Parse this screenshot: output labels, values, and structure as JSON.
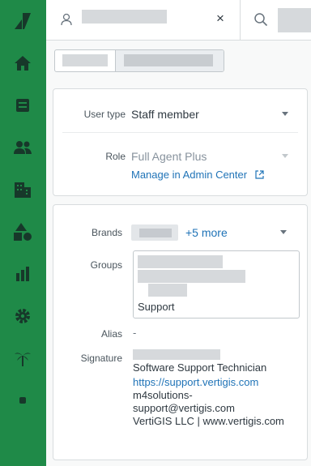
{
  "sidebar": {
    "items": [
      {
        "name": "zendesk-logo-icon"
      },
      {
        "name": "home-icon"
      },
      {
        "name": "views-icon"
      },
      {
        "name": "customers-icon"
      },
      {
        "name": "organizations-icon"
      },
      {
        "name": "objects-icon"
      },
      {
        "name": "reporting-icon"
      },
      {
        "name": "admin-icon"
      },
      {
        "name": "palm-tree-icon"
      },
      {
        "name": "apps-icon"
      }
    ],
    "bg_color": "#1f8a48"
  },
  "tabs": {
    "close_symbol": "×"
  },
  "user_card": {
    "user_type_label": "User type",
    "user_type_value": "Staff member",
    "role_label": "Role",
    "role_value": "Full Agent Plus",
    "manage_link": "Manage in Admin Center"
  },
  "details_card": {
    "brands_label": "Brands",
    "brands_more": "+5 more",
    "groups_label": "Groups",
    "groups_visible": "Support",
    "alias_label": "Alias",
    "alias_value": "-",
    "signature_label": "Signature",
    "signature_lines": [
      "Software Support Technician",
      "https://support.vertigis.com",
      "m4solutions-",
      "support@vertigis.com",
      "VertiGIS LLC | www.vertigis.com"
    ]
  },
  "colors": {
    "link": "#1f73b7",
    "accent_green": "#1f8a48"
  }
}
